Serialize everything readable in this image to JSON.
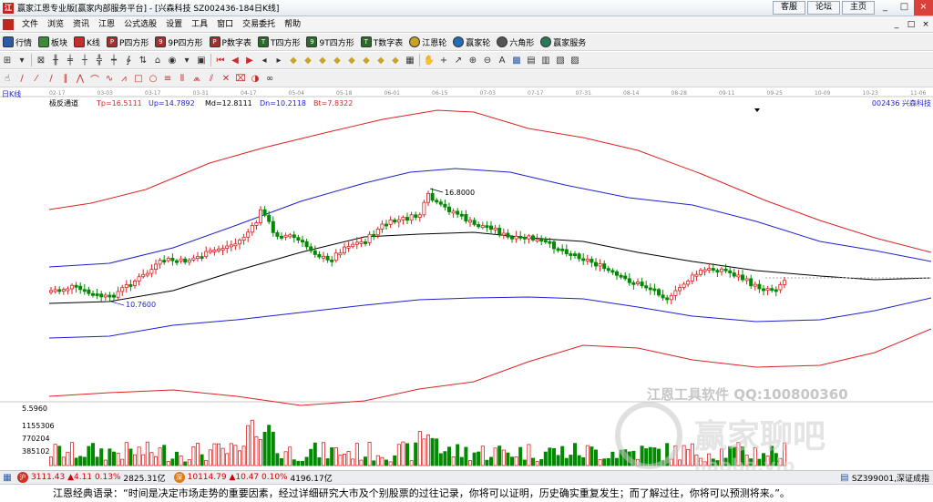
{
  "window": {
    "title": "赢家江恩专业版[赢家内部服务平台] - [兴森科技  SZ002436-184日K线]",
    "links": [
      "客服",
      "论坛",
      "主页"
    ],
    "controls": [
      "_",
      "□",
      "×"
    ]
  },
  "menu": {
    "items": [
      "文件",
      "浏览",
      "资讯",
      "江恩",
      "公式选股",
      "设置",
      "工具",
      "窗口",
      "交易委托",
      "帮助"
    ],
    "right": [
      "_",
      "□",
      "×"
    ]
  },
  "toolbar1": [
    "行情",
    "板块",
    "K线",
    "P四方形",
    "9P四方形",
    "P数字表",
    "T四方形",
    "9T四方形",
    "T数字表",
    "江恩轮",
    "赢家轮",
    "六角形",
    "赢家服务"
  ],
  "chart": {
    "period_label": "日K线",
    "stock_label": "002436  兴森科技",
    "indicator_name": "极反通道",
    "indicators": [
      "Tp=16.5111",
      "Up=14.7892",
      "Md=12.8111",
      "Dn=10.2118",
      "Bt=7.8322"
    ],
    "date_ticks": [
      "02-17",
      "03-03",
      "03-17",
      "03-31",
      "04-17",
      "05-04",
      "05-18",
      "06-01",
      "06-15",
      "07-03",
      "07-17",
      "07-31",
      "08-14",
      "08-28",
      "09-11",
      "09-25",
      "10-09",
      "10-23",
      "11-06"
    ],
    "high_label": "16.8000",
    "low_label": "10.7600",
    "volume_max_label": "5.5960",
    "volume_ticks": [
      "1155306",
      "770204",
      "385102"
    ],
    "watermark_line": "江恩工具软件  QQ:100800360",
    "watermark_logo": "赢家聊吧",
    "watermark_url": "jiaoba.vip"
  },
  "status": {
    "sh_index": "3111.43",
    "sh_change": "▲4.11",
    "sh_pct": "0.13%",
    "sh_amount": "2825.31亿",
    "sz_index": "10114.79",
    "sz_change": "▲10.47",
    "sz_pct": "0.10%",
    "sz_amount": "4196.17亿",
    "symbol": "SZ399001,深证成指"
  },
  "ticker": "江恩经典语录：“时间是决定市场走势的重要因素，经过详细研究大市及个别股票的过往记录，你将可以证明，历史确实重复发生；而了解过往，你将可以预测将来。”。",
  "colors": {
    "up": "#e02020",
    "down": "#008a00",
    "mid": "#000000",
    "inner_band": "#1f1fd2",
    "outer_band": "#dd2222"
  }
}
